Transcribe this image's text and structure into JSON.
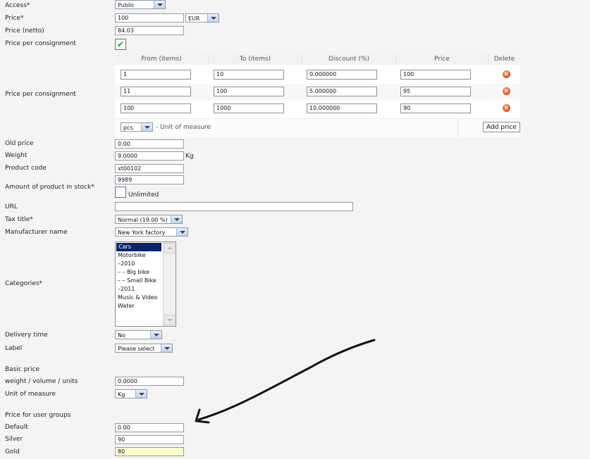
{
  "labels": {
    "access": "Access*",
    "price": "Price*",
    "price_netto": "Price (netto)",
    "price_per_consignment_1": "Price per consignment",
    "price_per_consignment_2": "Price per consignment",
    "old_price": "Old price",
    "weight": "Weight",
    "product_code": "Product code",
    "amount_in_stock": "Amount of product in stock*",
    "url": "URL",
    "tax_title": "Tax title*",
    "manufacturer_name": "Manufacturer name",
    "categories": "Categories*",
    "delivery_time": "Delivery time",
    "label": "Label",
    "basic_price": "Basic price",
    "weight_volume_units": "weight / volume / units",
    "unit_of_measure": "Unit of measure",
    "price_for_user_groups": "Price for user groups",
    "default": "Default",
    "silver": "Silver",
    "gold": "Gold"
  },
  "fields": {
    "access": "Public",
    "price": "100",
    "currency": "EUR",
    "price_netto": "84.03",
    "old_price": "0.00",
    "weight": "9.0000",
    "weight_unit": "Kg",
    "product_code": "xt00102",
    "stock": "9989",
    "unlimited_label": "Unlimited",
    "url": "",
    "tax_title": "Normal (19.00 %)",
    "manufacturer": "New York factory",
    "delivery_time": "No",
    "label": "Please select",
    "basic_price_value": "0.0000",
    "basic_unit": "Kg",
    "group_default": "0.00",
    "group_silver": "90",
    "group_gold": "80"
  },
  "consignment_table": {
    "headers": [
      "From (items)",
      "To (items)",
      "Discount (%)",
      "Price",
      "Delete"
    ],
    "rows": [
      {
        "from": "1",
        "to": "10",
        "discount": "0.000000",
        "price": "100"
      },
      {
        "from": "11",
        "to": "100",
        "discount": "5.000000",
        "price": "95"
      },
      {
        "from": "100",
        "to": "1000",
        "discount": "10.000000",
        "price": "90"
      }
    ],
    "unit_select": "pcs.",
    "unit_caption": "- Unit of measure",
    "add_price_label": "Add price",
    "delete_glyph": "✕"
  },
  "categories": [
    "Cars",
    "Motorbike",
    "–2010",
    "– – Big bike",
    "– – Small Bike",
    "–2011",
    "Music & Video",
    "Water"
  ],
  "checkbox_checked_glyph": "✔",
  "colors": {
    "background": "#f4f4f4",
    "checkbox_check": "#2e8a2e",
    "list_selected": "#0a246a",
    "gold_field_bg": "#ffffcc",
    "delete_icon": "#d94a16"
  }
}
